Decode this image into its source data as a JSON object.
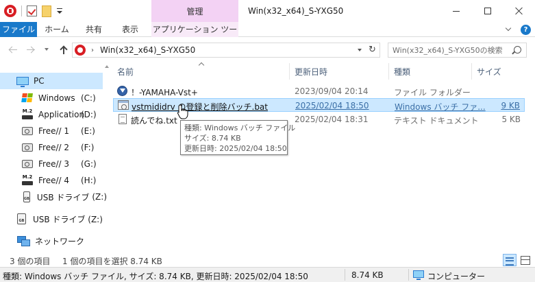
{
  "window": {
    "title": "Win(x32_x64)_S-YXG50",
    "contextual_group": "管理"
  },
  "ribbon": {
    "tabs": [
      "ファイル",
      "ホーム",
      "共有",
      "表示",
      "アプリケーション ツール"
    ],
    "help_glyph": "?"
  },
  "address": {
    "separator": "›",
    "path": "Win(x32_x64)_S-YXG50",
    "refresh_glyph": "↻"
  },
  "search": {
    "placeholder": "Win(x32_x64)_S-YXG50の検索"
  },
  "nav": {
    "pc": "PC",
    "drives": [
      {
        "label": "Windows",
        "letter": "(C:)",
        "icon": "windows-logo-icon"
      },
      {
        "label": "Application",
        "letter": "(D:)",
        "icon": "m2-drive-icon"
      },
      {
        "label": "Free// 1",
        "letter": "(E:)",
        "icon": "hard-disk-icon"
      },
      {
        "label": "Free// 2",
        "letter": "(F:)",
        "icon": "hard-disk-icon"
      },
      {
        "label": "Free// 3",
        "letter": "(G:)",
        "icon": "hard-disk-icon"
      },
      {
        "label": "Free// 4",
        "letter": "(H:)",
        "icon": "m2-drive-icon"
      },
      {
        "label": "USB ドライブ",
        "letter": "(Z:)",
        "icon": "usb-drive-icon"
      }
    ],
    "usb_root": "USB ドライブ (Z:)",
    "network": "ネットワーク",
    "m2_text": "M.2",
    "usb_text": "GB"
  },
  "columns": {
    "name": "名前",
    "date": "更新日時",
    "type": "種類",
    "size": "サイズ"
  },
  "files": [
    {
      "name": "！-YAMAHA-Vst+",
      "date": "2023/09/04 20:14",
      "type": "ファイル フォルダー",
      "size": "",
      "icon": "folder-yamaha-icon"
    },
    {
      "name": "vstmididrv の登録と削除バッチ.bat",
      "date": "2025/02/04 18:50",
      "type": "Windows バッチ ファ...",
      "size": "9 KB",
      "icon": "batch-file-icon"
    },
    {
      "name": "読んでね.txt",
      "date": "2025/02/04 18:31",
      "type": "テキスト ドキュメント",
      "size": "5 KB",
      "icon": "text-file-icon"
    }
  ],
  "tooltip": {
    "type_line": "種類: Windows バッチ ファイル",
    "size_line": "サイズ: 8.74 KB",
    "date_line": "更新日時: 2025/02/04 18:50"
  },
  "status": {
    "count": "3 個の項目",
    "selected": "1 個の項目を選択  8.74 KB"
  },
  "infobar": {
    "details": "種類: Windows バッチ ファイル, サイズ: 8.74 KB, 更新日時: 2025/02/04 18:50",
    "size": "8.74 KB",
    "location": "コンピューター"
  },
  "colors": {
    "file_tab": "#1979ca",
    "selection": "#cce8ff",
    "manage_tab": "#f3d2f4"
  }
}
